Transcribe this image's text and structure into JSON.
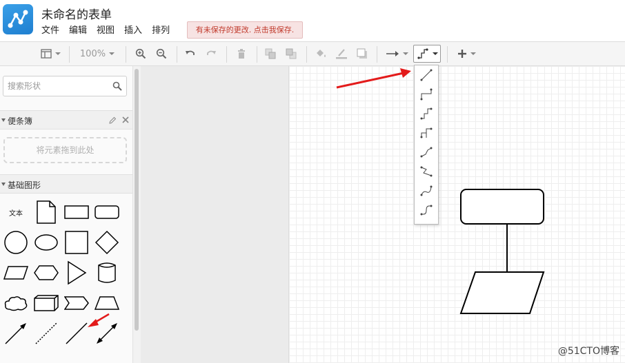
{
  "header": {
    "title": "未命名的表单",
    "menu": [
      "文件",
      "编辑",
      "视图",
      "插入",
      "排列"
    ],
    "unsaved_notice": "有未保存的更改. 点击我保存."
  },
  "toolbar": {
    "zoom": "100%",
    "icons": [
      "format-panel-icon",
      "zoom-in-icon",
      "zoom-out-icon",
      "undo-icon",
      "redo-icon",
      "delete-icon",
      "to-front-icon",
      "to-back-icon",
      "fill-color-icon",
      "line-color-icon",
      "shadow-icon",
      "connection-arrow-icon",
      "waypoints-icon",
      "insert-plus-icon"
    ]
  },
  "sidebar": {
    "search_placeholder": "搜索形状",
    "scratchpad_title": "便条簿",
    "scratchpad_drop_hint": "将元素拖到此处",
    "basic_shapes_title": "基础图形",
    "text_shape_label": "文本"
  },
  "waypoint_styles": [
    "straight",
    "orthogonal",
    "simple",
    "simple-alt",
    "isometric",
    "isometric-alt",
    "curved",
    "entity-relation"
  ],
  "watermark": "@51CTO博客",
  "colors": {
    "annotation_arrow": "#e31b1b",
    "unsaved_bg": "#f7e3e3",
    "unsaved_text": "#c0392b",
    "logo": "#2a8fe0"
  }
}
